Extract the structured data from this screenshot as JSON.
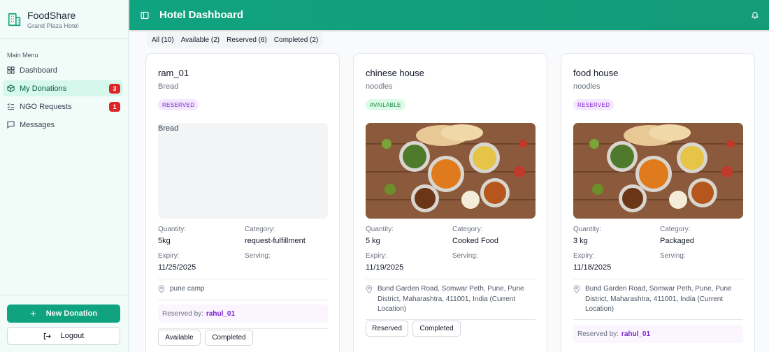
{
  "brand": {
    "name": "FoodShare",
    "subtitle": "Grand Plaza Hotel"
  },
  "sidebar": {
    "menu_title": "Main Menu",
    "items": [
      {
        "label": "Dashboard",
        "icon": "grid-icon"
      },
      {
        "label": "My Donations",
        "icon": "package-icon",
        "badge": "3",
        "active": true
      },
      {
        "label": "NGO Requests",
        "icon": "list-check-icon",
        "badge": "1"
      },
      {
        "label": "Messages",
        "icon": "message-icon"
      }
    ],
    "new_donation_label": "New Donation",
    "logout_label": "Logout"
  },
  "header": {
    "title": "Hotel Dashboard"
  },
  "tabs": [
    "All (10)",
    "Available (2)",
    "Reserved (6)",
    "Completed (2)"
  ],
  "labels": {
    "quantity": "Quantity:",
    "category": "Category:",
    "expiry": "Expiry:",
    "serving": "Serving:",
    "reserved_by": "Reserved by:"
  },
  "cards": [
    {
      "title": "ram_01",
      "subtitle": "Bread",
      "status": "RESERVED",
      "image_alt": "Bread",
      "quantity": "5kg",
      "category": "request-fulfillment",
      "expiry": "11/25/2025",
      "serving": "",
      "location": "pune camp",
      "reserved_by": "rahul_01",
      "actions": [
        "Available",
        "Completed"
      ]
    },
    {
      "title": "chinese house",
      "subtitle": "noodles",
      "status": "AVAILABLE",
      "quantity": "5 kg",
      "category": "Cooked Food",
      "expiry": "11/19/2025",
      "serving": "",
      "location": "Bund Garden Road, Somwar Peth, Pune, Pune District, Maharashtra, 411001, India (Current Location)",
      "actions": [
        "Reserved",
        "Completed"
      ]
    },
    {
      "title": "food house",
      "subtitle": "noodles",
      "status": "RESERVED",
      "quantity": "3 kg",
      "category": "Packaged",
      "expiry": "11/18/2025",
      "serving": "",
      "location": "Bund Garden Road, Somwar Peth, Pune, Pune District, Maharashtra, 411001, India (Current Location)",
      "reserved_by": "rahul_01"
    }
  ],
  "colors": {
    "primary": "#10a37f",
    "badge": "#dc2626",
    "reserved": "#7e22ce",
    "available": "#15803d"
  }
}
